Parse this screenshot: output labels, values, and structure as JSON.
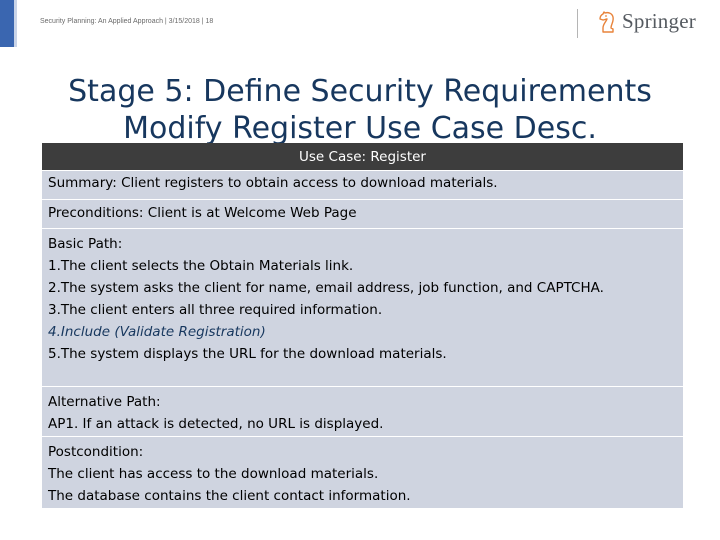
{
  "header": {
    "citation": "Security Planning: An Applied Approach | 3/15/2018 | 18",
    "logo_text": "Springer"
  },
  "title": {
    "line1": "Stage 5: Define Security Requirements",
    "line2": "Modify Register Use Case Desc."
  },
  "table": {
    "heading": "Use Case: Register",
    "summary": {
      "label": "Summary",
      "text": ": Client registers to obtain access to download materials."
    },
    "preconditions": {
      "label": "Preconditions",
      "text": ": Client is at Welcome Web Page"
    },
    "basic_path": {
      "label": "Basic Path",
      "suffix": ":",
      "steps": [
        "1.The client selects the Obtain Materials link.",
        "2.The system asks the client for name, email address, job function, and CAPTCHA.",
        "3.The client enters all three required information.",
        "4.Include (Validate Registration)",
        "5.The system displays the URL for the download materials."
      ]
    },
    "alternative_path": {
      "label": "Alternative Path",
      "suffix": ":",
      "text": "AP1.  If an attack is detected, no URL is displayed."
    },
    "postcondition": {
      "label": "Postcondition",
      "suffix": ":",
      "lines": [
        "The client has access to the download materials.",
        "The database contains the client contact information."
      ]
    }
  },
  "colors": {
    "accent": "#3a66b0",
    "title": "#17375e",
    "table_head": "#3d3d3d",
    "table_row": "#cfd4e0"
  }
}
